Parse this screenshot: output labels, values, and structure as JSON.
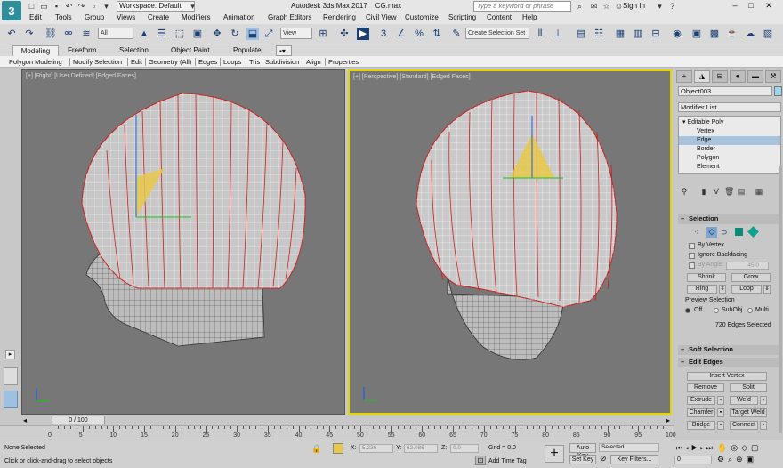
{
  "titlebar": {
    "workspace": "Workspace: Default",
    "app_title": "Autodesk 3ds Max 2017",
    "file_name": "CG.max",
    "search_placeholder": "Type a keyword or phrase",
    "sign_in": "Sign In"
  },
  "menu": [
    "Edit",
    "Tools",
    "Group",
    "Views",
    "Create",
    "Modifiers",
    "Animation",
    "Graph Editors",
    "Rendering",
    "Civil View",
    "Customize",
    "Scripting",
    "Content",
    "Help"
  ],
  "toolbar": {
    "filter": "All",
    "view": "View",
    "selection_set": "Create Selection Set"
  },
  "ribbon": {
    "tabs": [
      "Modeling",
      "Freeform",
      "Selection",
      "Object Paint",
      "Populate"
    ],
    "sub_items": [
      "Polygon Modeling",
      "Modify Selection",
      "Edit",
      "Geometry (All)",
      "Edges",
      "Loops",
      "Tris",
      "Subdivision",
      "Align",
      "Properties"
    ]
  },
  "viewports": {
    "right_label": "[+] [Right] [User Defined] [Edged Faces]",
    "persp_label": "[+] [Perspective] [Standard] [Edged Faces]"
  },
  "command_panel": {
    "object_name": "Object003",
    "modifier_list": "Modifier List",
    "stack": [
      "Editable Poly",
      "Vertex",
      "Edge",
      "Border",
      "Polygon",
      "Element"
    ],
    "selected_stack_item": "Edge",
    "selection": {
      "title": "Selection",
      "by_vertex": "By Vertex",
      "ignore_backfacing": "Ignore Backfacing",
      "by_angle": "By Angle:",
      "angle_value": "45.0",
      "shrink": "Shrink",
      "grow": "Grow",
      "ring": "Ring",
      "loop": "Loop",
      "preview_title": "Preview Selection",
      "preview_off": "Off",
      "preview_subobj": "SubObj",
      "preview_multi": "Multi",
      "status": "720 Edges Selected"
    },
    "soft_selection": "Soft Selection",
    "edit_edges": {
      "title": "Edit Edges",
      "insert_vertex": "Insert Vertex",
      "remove": "Remove",
      "split": "Split",
      "extrude": "Extrude",
      "weld": "Weld",
      "chamfer": "Chamfer",
      "target_weld": "Target Weld",
      "bridge": "Bridge",
      "connect": "Connect"
    }
  },
  "timeline": {
    "frame": "0 / 100",
    "ticks": [
      "0",
      "5",
      "10",
      "15",
      "20",
      "25",
      "30",
      "35",
      "40",
      "45",
      "50",
      "55",
      "60",
      "65",
      "70",
      "75",
      "80",
      "85",
      "90",
      "95",
      "100"
    ]
  },
  "status": {
    "selection": "None Selected",
    "prompt": "Click or click-and-drag to select objects",
    "x_label": "X:",
    "x_value": "5.236",
    "y_label": "Y:",
    "y_value": "62.086",
    "z_label": "Z:",
    "z_value": "0.0",
    "grid": "Grid = 0.0",
    "add_time_tag": "Add Time Tag",
    "auto_key": "Auto Key",
    "set_key": "Set Key",
    "key_mode": "Selected",
    "key_filters": "Key Filters..."
  },
  "colors": {
    "viewport_bg": "#777777",
    "active_border": "#e6d600",
    "wire_red": "#cc2020",
    "selected_item": "#a9c3dd"
  }
}
